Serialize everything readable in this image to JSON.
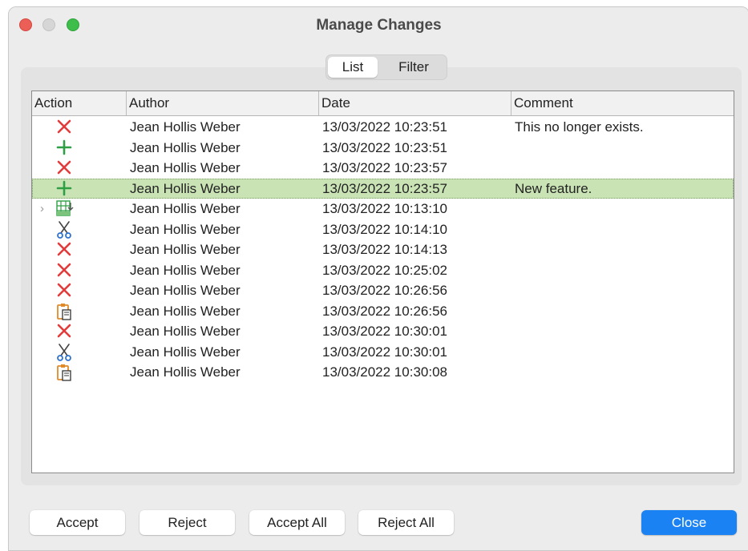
{
  "window": {
    "title": "Manage Changes"
  },
  "tabs": [
    {
      "label": "List",
      "selected": true
    },
    {
      "label": "Filter",
      "selected": false
    }
  ],
  "table": {
    "columns": [
      "Action",
      "Author",
      "Date",
      "Comment"
    ],
    "rows": [
      {
        "icon": "delete-x-icon",
        "author": "Jean Hollis Weber",
        "date": "13/03/2022 10:23:51",
        "comment": "This no longer exists."
      },
      {
        "icon": "insert-plus-icon",
        "author": "Jean Hollis Weber",
        "date": "13/03/2022 10:23:51",
        "comment": ""
      },
      {
        "icon": "delete-x-icon",
        "author": "Jean Hollis Weber",
        "date": "13/03/2022 10:23:57",
        "comment": ""
      },
      {
        "icon": "insert-plus-icon",
        "author": "Jean Hollis Weber",
        "date": "13/03/2022 10:23:57",
        "comment": "New feature.",
        "selected": true
      },
      {
        "icon": "table-insert-icon",
        "author": "Jean Hollis Weber",
        "date": "13/03/2022 10:13:10",
        "comment": "",
        "expandable": true
      },
      {
        "icon": "scissors-icon",
        "author": "Jean Hollis Weber",
        "date": "13/03/2022 10:14:10",
        "comment": ""
      },
      {
        "icon": "delete-x-icon",
        "author": "Jean Hollis Weber",
        "date": "13/03/2022 10:14:13",
        "comment": ""
      },
      {
        "icon": "delete-x-icon",
        "author": "Jean Hollis Weber",
        "date": "13/03/2022 10:25:02",
        "comment": ""
      },
      {
        "icon": "delete-x-icon",
        "author": "Jean Hollis Weber",
        "date": "13/03/2022 10:26:56",
        "comment": ""
      },
      {
        "icon": "clipboard-paste-icon",
        "author": "Jean Hollis Weber",
        "date": "13/03/2022 10:26:56",
        "comment": ""
      },
      {
        "icon": "delete-x-icon",
        "author": "Jean Hollis Weber",
        "date": "13/03/2022 10:30:01",
        "comment": ""
      },
      {
        "icon": "scissors-icon",
        "author": "Jean Hollis Weber",
        "date": "13/03/2022 10:30:01",
        "comment": ""
      },
      {
        "icon": "clipboard-paste-icon",
        "author": "Jean Hollis Weber",
        "date": "13/03/2022 10:30:08",
        "comment": ""
      }
    ]
  },
  "buttons": {
    "accept": "Accept",
    "reject": "Reject",
    "accept_all": "Accept All",
    "reject_all": "Reject All",
    "close": "Close"
  },
  "colors": {
    "delete": "#e23b3b",
    "insert": "#2ea043",
    "selected_row": "#c9e3b5",
    "primary_button": "#1b82f4"
  }
}
